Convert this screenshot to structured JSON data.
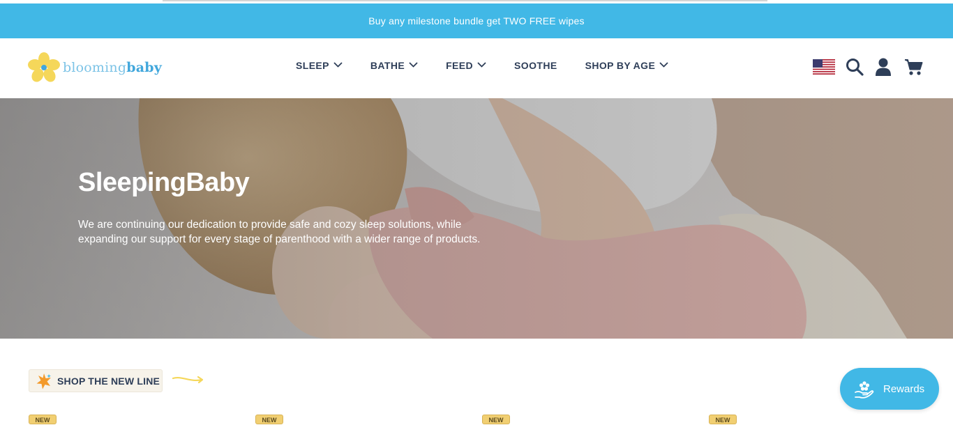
{
  "announcement": {
    "text": "Buy any milestone bundle get TWO FREE wipes"
  },
  "logo": {
    "word1": "blooming",
    "word2": "baby"
  },
  "nav": {
    "items": [
      {
        "label": "SLEEP",
        "has_dropdown": true
      },
      {
        "label": "BATHE",
        "has_dropdown": true
      },
      {
        "label": "FEED",
        "has_dropdown": true
      },
      {
        "label": "SOOTHE",
        "has_dropdown": false
      },
      {
        "label": "SHOP BY AGE",
        "has_dropdown": true
      }
    ]
  },
  "header_icons": [
    "us-flag-icon",
    "search-icon",
    "account-icon",
    "cart-icon"
  ],
  "hero": {
    "title": "SleepingBaby",
    "description": "We are continuing our dedication to provide safe and cozy sleep solutions, while expanding our support for every stage of parenthood with a wider range of products."
  },
  "shop_new_line": {
    "label": "SHOP THE NEW LINE"
  },
  "product_tags": [
    "NEW",
    "NEW",
    "NEW",
    "NEW"
  ],
  "rewards": {
    "label": "Rewards"
  },
  "colors": {
    "brand_blue": "#41b8e6",
    "nav_text": "#2e3e58",
    "logo_yellow": "#f5d75a"
  }
}
